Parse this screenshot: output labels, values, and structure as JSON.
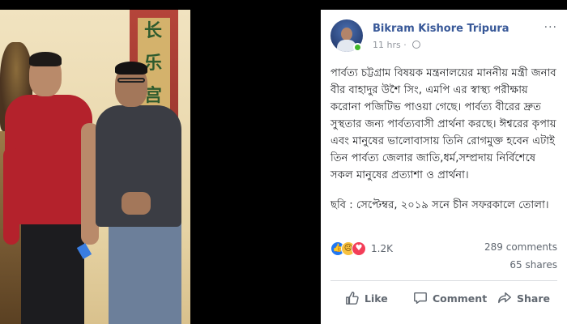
{
  "post": {
    "author": "Bikram Kishore Tripura",
    "time": "11 hrs",
    "dot": "·",
    "more": "···",
    "paragraphs": [
      "পার্বত্য চট্টগ্রাম বিষয়ক মন্ত্রনালয়ের মাননীয় মন্ত্রী জনাব বীর বাহাদুর উশৈ সিং, এমপি এর স্বাস্থ্য পরীক্ষায় করোনা পজিটিভ পাওয়া গেছে। পার্বত্য বীরের দ্রুত সুস্থতার জন্য পার্বত্যবাসী প্রার্থনা করছে। ঈশ্বরের কৃপায় এবং মানুষের ভালোবাসায় তিনি রোগমুক্ত হবেন এটাই তিন পার্বত্য জেলার জাতি,ধর্ম,সম্প্রদায় নির্বিশেষে সকল মানুষের প্রত্যাশা ও প্রার্থনা।",
      "ছবি : সেপ্টেম্বর, ২০১৯ সনে চীন সফরকালে তোলা।"
    ],
    "reaction_count": "1.2K",
    "comments": "289 comments",
    "shares": "65 shares",
    "actions": {
      "like": "Like",
      "comment": "Comment",
      "share": "Share"
    }
  },
  "photo": {
    "calligraphy": [
      "长",
      "乐",
      "宫"
    ]
  },
  "colors": {
    "author_link": "#385898",
    "like_blue": "#2078f4",
    "love_red": "#f33e58",
    "sad_yellow": "#f7c140",
    "online_green": "#42b72a"
  },
  "icons": [
    "globe-icon",
    "more-icon",
    "like-reaction-icon",
    "sad-reaction-icon",
    "love-reaction-icon",
    "thumbs-up-icon",
    "comment-icon",
    "share-icon"
  ]
}
